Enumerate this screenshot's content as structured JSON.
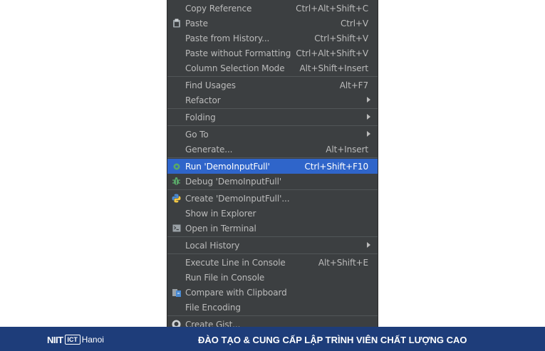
{
  "menu": {
    "items": [
      {
        "label": "Copy Reference",
        "shortcut": "Ctrl+Alt+Shift+C"
      },
      {
        "label": "Paste",
        "shortcut": "Ctrl+V",
        "icon": "clipboard-icon"
      },
      {
        "label": "Paste from History...",
        "shortcut": "Ctrl+Shift+V"
      },
      {
        "label": "Paste without Formatting",
        "shortcut": "Ctrl+Alt+Shift+V"
      },
      {
        "label": "Column Selection Mode",
        "shortcut": "Alt+Shift+Insert"
      },
      {
        "label": "Find Usages",
        "shortcut": "Alt+F7"
      },
      {
        "label": "Refactor",
        "submenu": true
      },
      {
        "label": "Folding",
        "submenu": true
      },
      {
        "label": "Go To",
        "submenu": true
      },
      {
        "label": "Generate...",
        "shortcut": "Alt+Insert"
      },
      {
        "label": "Run 'DemoInputFull'",
        "shortcut": "Ctrl+Shift+F10",
        "icon": "run-icon",
        "selected": true
      },
      {
        "label": "Debug 'DemoInputFull'",
        "icon": "debug-bug-icon"
      },
      {
        "label": "Create 'DemoInputFull'...",
        "icon": "python-icon"
      },
      {
        "label": "Show in Explorer"
      },
      {
        "label": "Open in Terminal",
        "icon": "terminal-icon"
      },
      {
        "label": "Local History",
        "submenu": true
      },
      {
        "label": "Execute Line in Console",
        "shortcut": "Alt+Shift+E"
      },
      {
        "label": "Run File in Console"
      },
      {
        "label": "Compare with Clipboard",
        "icon": "compare-icon"
      },
      {
        "label": "File Encoding"
      },
      {
        "label": "Create Gist...",
        "icon": "github-icon"
      }
    ]
  },
  "banner": {
    "logo_niit": "NIIT",
    "logo_it": "ICT",
    "logo_city": "Hanoi",
    "tagline": "ĐÀO TẠO & CUNG CẤP LẬP TRÌNH VIÊN CHẤT LƯỢNG CAO"
  },
  "colors": {
    "menu_bg": "#3c3f41",
    "menu_text": "#bbbbbb",
    "selection": "#2f65ca",
    "banner_bg": "#1e3d7a"
  }
}
